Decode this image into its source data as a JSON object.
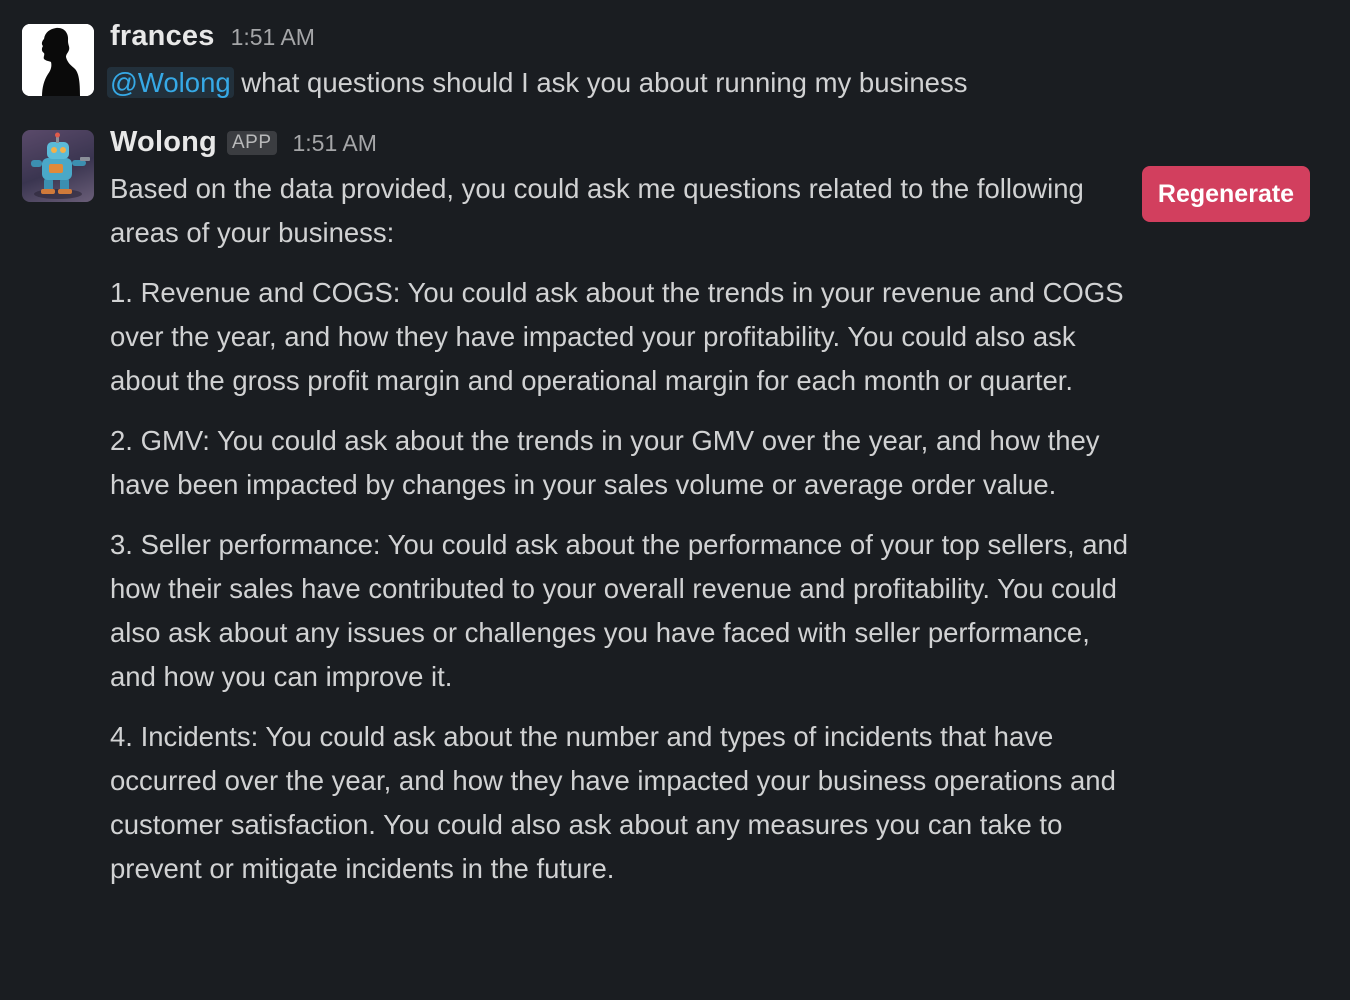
{
  "messages": [
    {
      "author": "frances",
      "time": "1:51 AM",
      "mention": "@Wolong",
      "text": " what questions should I ask you about running my business",
      "avatar_icon": "silhouette-avatar-icon"
    },
    {
      "author": "Wolong",
      "badge": "APP",
      "time": "1:51 AM",
      "avatar_icon": "robot-avatar-icon",
      "paragraphs": [
        "Based on the data provided, you could ask me questions related to the following areas of your business:",
        "1. Revenue and COGS: You could ask about the trends in your revenue and COGS over the year, and how they have impacted your profitability. You could also ask about the gross profit margin and operational margin for each month or quarter.",
        "2. GMV: You could ask about the trends in your GMV over the year, and how they have been impacted by changes in your sales volume or average order value.",
        "3. Seller performance: You could ask about the performance of your top sellers, and how their sales have contributed to your overall revenue and profitability. You could also ask about any issues or challenges you have faced with seller performance, and how you can improve it.",
        "4. Incidents: You could ask about the number and types of incidents that have occurred over the year, and how they have impacted your business operations and customer satisfaction. You could also ask about any measures you can take to prevent or mitigate incidents in the future."
      ]
    }
  ],
  "actions": {
    "regenerate_label": "Regenerate",
    "regenerate_color": "#d23f5e"
  },
  "colors": {
    "background": "#1a1d21",
    "text": "#d1d2d3",
    "mention": "#36a9e6"
  }
}
